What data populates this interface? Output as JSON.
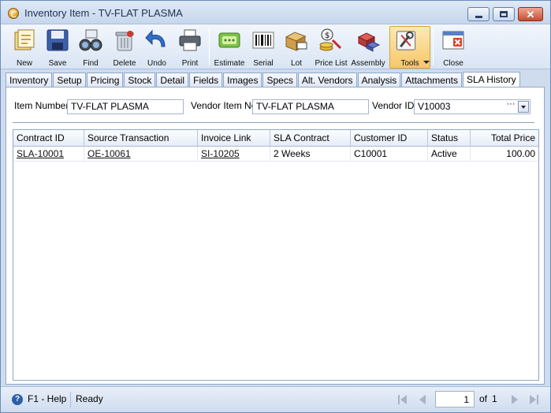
{
  "window": {
    "title": "Inventory Item - TV-FLAT PLASMA"
  },
  "toolbar": {
    "new": "New",
    "save": "Save",
    "find": "Find",
    "delete": "Delete",
    "undo": "Undo",
    "print": "Print",
    "estimate": "Estimate",
    "serial": "Serial",
    "lot": "Lot",
    "price_list": "Price List",
    "assembly": "Assembly",
    "tools": "Tools",
    "close": "Close"
  },
  "tabs": [
    "Inventory",
    "Setup",
    "Pricing",
    "Stock",
    "Detail",
    "Fields",
    "Images",
    "Specs",
    "Alt. Vendors",
    "Analysis",
    "Attachments",
    "SLA History"
  ],
  "active_tab": "SLA History",
  "form": {
    "item_number_label": "Item Number",
    "item_number": "TV-FLAT PLASMA",
    "vendor_item_no_label": "Vendor Item No",
    "vendor_item_no": "TV-FLAT PLASMA",
    "vendor_id_label": "Vendor ID",
    "vendor_id": "V10003"
  },
  "grid": {
    "columns": [
      "Contract ID",
      "Source Transaction",
      "Invoice Link",
      "SLA Contract",
      "Customer ID",
      "Status",
      "Total Price"
    ],
    "rows": [
      {
        "contract_id": "SLA-10001",
        "source_transaction": "OE-10061",
        "invoice_link": "SI-10205",
        "sla_contract": "2 Weeks",
        "customer_id": "C10001",
        "status": "Active",
        "total_price": "100.00"
      }
    ]
  },
  "statusbar": {
    "help": "F1 - Help",
    "status": "Ready",
    "page": "1",
    "of": "of",
    "total_pages": "1"
  }
}
